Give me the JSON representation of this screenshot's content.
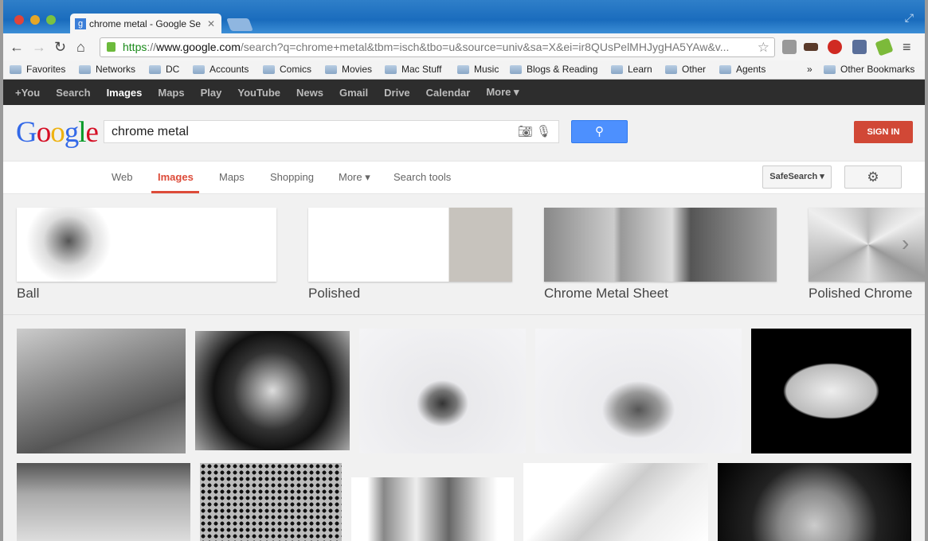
{
  "browser": {
    "tab_title": "chrome metal - Google Se",
    "tab_favicon": "g",
    "url_scheme": "https",
    "url_sep": "://",
    "url_domain": "www.google.com",
    "url_rest": "/search?q=chrome+metal&tbm=isch&tbo=u&source=univ&sa=X&ei=ir8QUsPelMHJygHA5YAw&v...",
    "bookmarks": [
      "Favorites",
      "Networks",
      "DC",
      "Accounts",
      "Comics",
      "Movies",
      "Mac Stuff",
      "Music",
      "Blogs & Reading",
      "Learn",
      "Other",
      "Agents"
    ],
    "overflow": "»",
    "other_bookmarks": "Other Bookmarks"
  },
  "gbar": {
    "items": [
      "+You",
      "Search",
      "Images",
      "Maps",
      "Play",
      "YouTube",
      "News",
      "Gmail",
      "Drive",
      "Calendar",
      "More ▾"
    ],
    "active": "Images"
  },
  "search": {
    "logo": "Google",
    "query": "chrome metal",
    "sign_in": "SIGN IN"
  },
  "tabs": {
    "items": [
      "Web",
      "Images",
      "Maps",
      "Shopping",
      "More ▾",
      "Search tools"
    ],
    "active": "Images",
    "safesearch": "SafeSearch ▾"
  },
  "related": [
    {
      "label": "Ball"
    },
    {
      "label": "Polished"
    },
    {
      "label": "Chrome Metal Sheet"
    },
    {
      "label": "Polished Chrome"
    }
  ],
  "colors": {
    "accent_red": "#dd4b39",
    "search_blue": "#4d90fe",
    "signin_red": "#d14836"
  }
}
